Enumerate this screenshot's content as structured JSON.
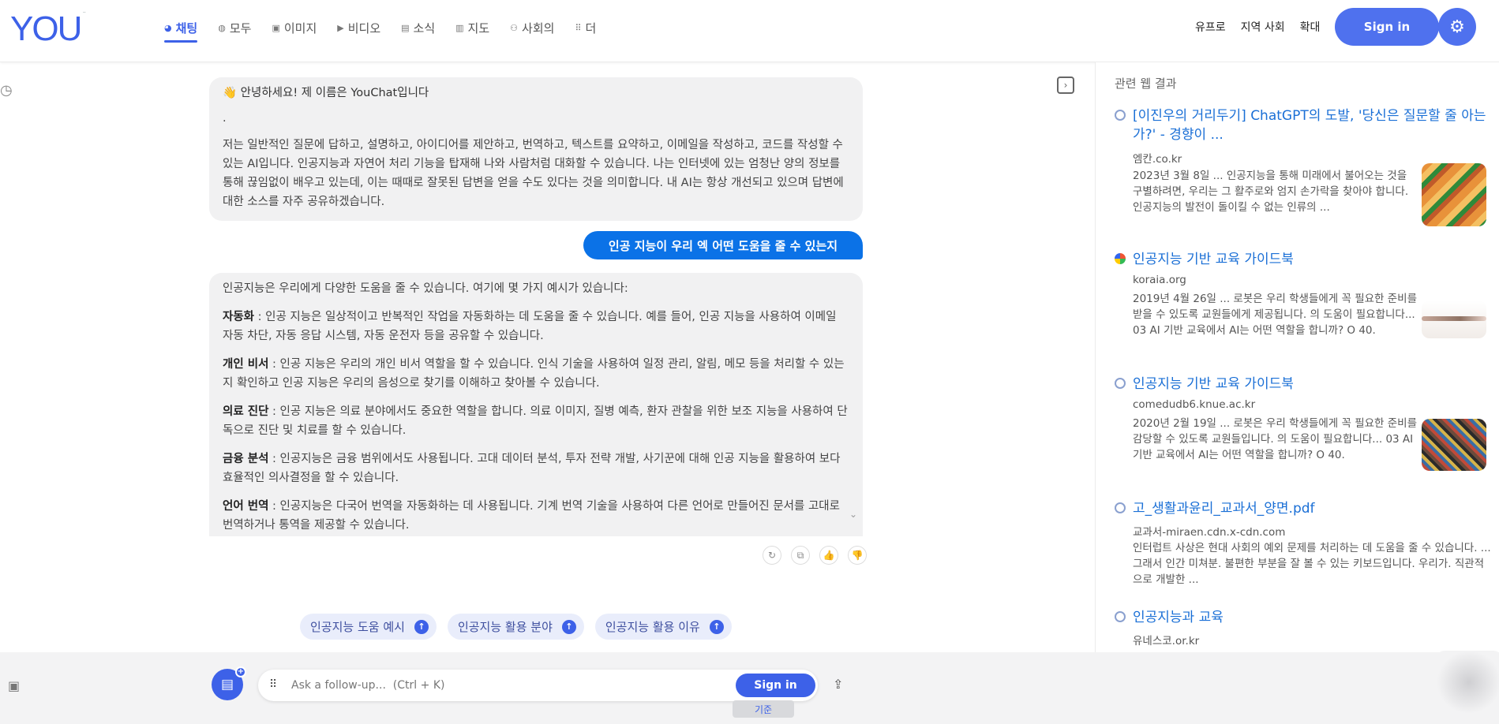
{
  "header": {
    "logo": "YOU",
    "nav": [
      {
        "icon": "chat-icon",
        "glyph": "◕",
        "label": "채팅",
        "active": true
      },
      {
        "icon": "search-icon",
        "glyph": "◍",
        "label": "모두",
        "active": false
      },
      {
        "icon": "image-icon",
        "glyph": "▣",
        "label": "이미지",
        "active": false
      },
      {
        "icon": "video-icon",
        "glyph": "▶",
        "label": "비디오",
        "active": false
      },
      {
        "icon": "news-icon",
        "glyph": "▤",
        "label": "소식",
        "active": false
      },
      {
        "icon": "map-icon",
        "glyph": "▥",
        "label": "지도",
        "active": false
      },
      {
        "icon": "people-icon",
        "glyph": "⚇",
        "label": "사회의",
        "active": false
      },
      {
        "icon": "more-icon",
        "glyph": "⠿",
        "label": "더",
        "active": false
      }
    ],
    "links": [
      "유프로",
      "지역 사회",
      "확대"
    ],
    "sign_in": "Sign in"
  },
  "chat": {
    "bot_intro": {
      "title": "👋 안녕하세요! 제 이름은 YouChat입니다",
      "dot": ".",
      "body": "저는 일반적인 질문에 답하고, 설명하고, 아이디어를 제안하고, 번역하고, 텍스트를 요약하고, 이메일을 작성하고, 코드를 작성할 수 있는 AI입니다. 인공지능과 자연어 처리 기능을 탑재해 나와 사람처럼 대화할 수 있습니다. 나는 인터넷에 있는 엄청난 양의 정보를 통해 끊임없이 배우고 있는데, 이는 때때로 잘못된 답변을 얻을 수도 있다는 것을 의미합니다. 내 AI는 항상 개선되고 있으며 답변에 대한 소스를 자주 공유하겠습니다."
    },
    "user_message": "인공 지능이 우리 엑 어떤 도움을 줄 수 있는지",
    "bot_answer": {
      "intro": "인공지능은 우리에게 다양한 도움을 줄 수 있습니다. 여기에 몇 가지 예시가 있습니다:",
      "items": [
        {
          "term": "자동화",
          "text": " : 인공 지능은 일상적이고 반복적인 작업을 자동화하는 데 도움을 줄 수 있습니다. 예를 들어, 인공 지능을 사용하여 이메일 자동 차단, 자동 응답 시스템, 자동 운전자 등을 공유할 수 있습니다."
        },
        {
          "term": "개인 비서",
          "text": " : 인공 지능은 우리의 개인 비서 역할을 할 수 있습니다. 인식 기술을 사용하여 일정 관리, 알림, 메모 등을 처리할 수 있는지 확인하고 인공 지능은 우리의 음성으로 찾기를 이해하고 찾아볼 수 있습니다."
        },
        {
          "term": "의료 진단",
          "text": " : 인공 지능은 의료 분야에서도 중요한 역할을 합니다. 의료 이미지, 질병 예측, 환자 관찰을 위한 보조 지능을 사용하여 단독으로 진단 및 치료를 할 수 있습니다."
        },
        {
          "term": "금융 분석",
          "text": " : 인공지능은 금융 범위에서도 사용됩니다. 고대 데이터 분석, 투자 전략 개발, 사기꾼에 대해 인공 지능을 활용하여 보다 효율적인 의사결정을 할 수 있습니다."
        },
        {
          "term": "언어 번역",
          "text": " : 인공지능은 다국어 번역을 자동화하는 데 사용됩니다. 기계 번역 기술을 사용하여 다른 언어로 만들어진 문서를 고대로 번역하거나 통역을 제공할 수 있습니다."
        }
      ]
    },
    "suggestions": [
      "인공지능 도움 예시",
      "인공지능 활용 분야",
      "인공지능 활용 이유"
    ]
  },
  "composer": {
    "placeholder": "Ask a follow-up...  (Ctrl + K)",
    "sign_in": "Sign in",
    "mode": "기준"
  },
  "web_results": {
    "heading": "관련 웹 결과",
    "items": [
      {
        "title": "[이진우의 거리두기] ChatGPT의 도발, '당신은 질문할 줄 아는가?' - 경향이 ...",
        "source": "엠칸.co.kr",
        "snippet": "2023년 3월 8일 ... 인공지능을 통해 미래에서 불어오는 것을 구별하려면, 우리는 그 활주로와 엄지 손가락을 찾아야 합니다. 인공지능의 발전이 돌이킬 수 없는 인류의 ..."
      },
      {
        "title": "인공지능 기반 교육 가이드북",
        "source": "koraia.org",
        "snippet": "2019년 4월 26일 ... 로봇은 우리 학생들에게 꼭 필요한 준비를 받을 수 있도록 교원들에게 제공됩니다. 의 도움이 필요합니다... 03 AI 기반 교육에서 AI는 어떤 역할을 합니까? O 40."
      },
      {
        "title": "인공지능 기반 교육 가이드북",
        "source": "comedudb6.knue.ac.kr",
        "snippet": "2020년 2월 19일 ... 로봇은 우리 학생들에게 꼭 필요한 준비를 감당할 수 있도록 교원들입니다. 의 도움이 필요합니다... 03 AI 기반 교육에서 AI는 어떤 역할을 합니까? O 40."
      },
      {
        "title": "고_생활과윤리_교과서_양면.pdf",
        "source": "교과서-miraen.cdn.x-cdn.com",
        "snippet": "인터럽트 사상은 현대 사회의 예외 문제를 처리하는 데 도움을 줄 수 있습니다. ... 그래서 인간 미쳐분. 불편한 부분을 잘 볼 수 있는 키보드입니다. 우리가. 직관적으로 개발한 ..."
      },
      {
        "title": "인공지능과 교육",
        "source": "유네스코.or.kr",
        "snippet": ""
      }
    ]
  }
}
